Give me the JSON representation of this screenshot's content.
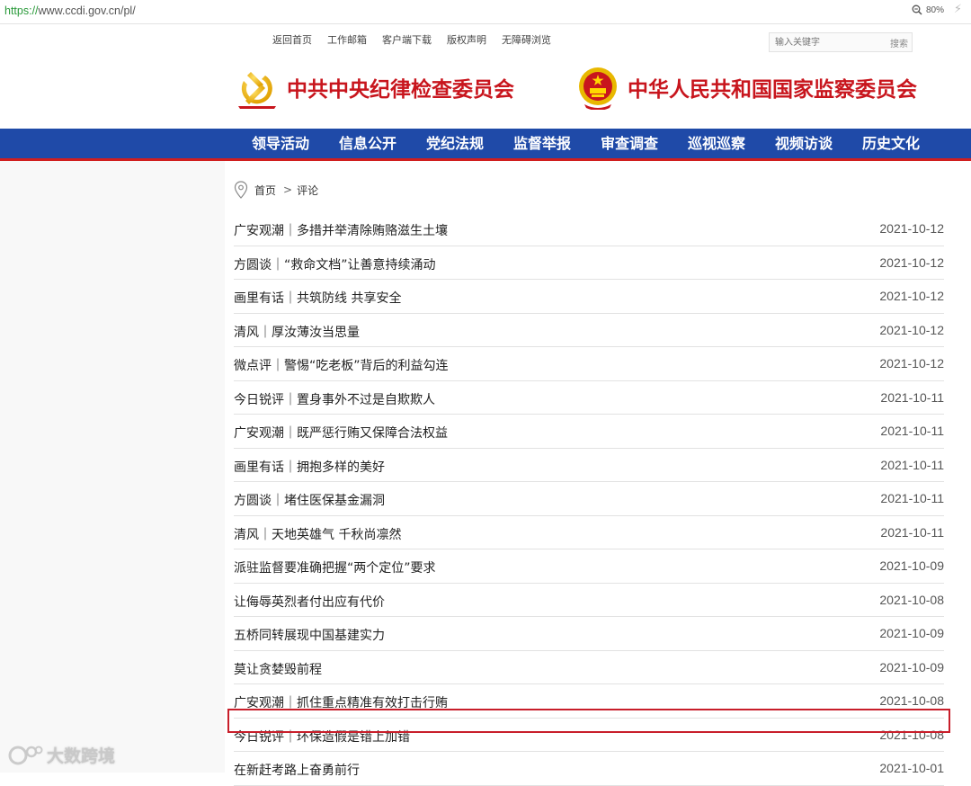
{
  "browser": {
    "url_scheme": "https://",
    "url_rest": "www.ccdi.gov.cn/pl/",
    "zoom": "80%"
  },
  "top_links": [
    "返回首页",
    "工作邮箱",
    "客户端下载",
    "版权声明",
    "无障碍浏览"
  ],
  "search": {
    "placeholder": "输入关键字",
    "button": "搜索"
  },
  "logos": {
    "left": "中共中央纪律检查委员会",
    "right": "中华人民共和国国家监察委员会"
  },
  "nav": [
    "领导活动",
    "信息公开",
    "党纪法规",
    "监督举报",
    "审查调查",
    "巡视巡察",
    "视频访谈",
    "历史文化"
  ],
  "breadcrumb": {
    "home": "首页",
    "sep": ">",
    "current": "评论"
  },
  "articles": [
    {
      "title": "广安观潮｜多措并举清除贿赂滋生土壤",
      "date": "2021-10-12"
    },
    {
      "title": "方圆谈｜“救命文档”让善意持续涌动",
      "date": "2021-10-12"
    },
    {
      "title": "画里有话｜共筑防线 共享安全",
      "date": "2021-10-12"
    },
    {
      "title": "清风｜厚汝薄汝当思量",
      "date": "2021-10-12"
    },
    {
      "title": "微点评｜警惕“吃老板”背后的利益勾连",
      "date": "2021-10-12"
    },
    {
      "title": "今日锐评｜置身事外不过是自欺欺人",
      "date": "2021-10-11"
    },
    {
      "title": "广安观潮｜既严惩行贿又保障合法权益",
      "date": "2021-10-11"
    },
    {
      "title": "画里有话｜拥抱多样的美好",
      "date": "2021-10-11"
    },
    {
      "title": "方圆谈｜堵住医保基金漏洞",
      "date": "2021-10-11"
    },
    {
      "title": "清风｜天地英雄气 千秋尚凛然",
      "date": "2021-10-11"
    },
    {
      "title": "派驻监督要准确把握“两个定位”要求",
      "date": "2021-10-09"
    },
    {
      "title": "让侮辱英烈者付出应有代价",
      "date": "2021-10-08"
    },
    {
      "title": "五桥同转展现中国基建实力",
      "date": "2021-10-09"
    },
    {
      "title": "莫让贪婪毁前程",
      "date": "2021-10-09"
    },
    {
      "title": "广安观潮｜抓住重点精准有效打击行贿",
      "date": "2021-10-08"
    },
    {
      "title": "今日锐评｜环保造假是错上加错",
      "date": "2021-10-08"
    },
    {
      "title": "在新赶考路上奋勇前行",
      "date": "2021-10-01"
    }
  ],
  "watermark": "大数跨境",
  "colors": {
    "nav_bg": "#1f4aa8",
    "brand_red": "#c8151d",
    "highlight_border": "#c81e2a"
  }
}
